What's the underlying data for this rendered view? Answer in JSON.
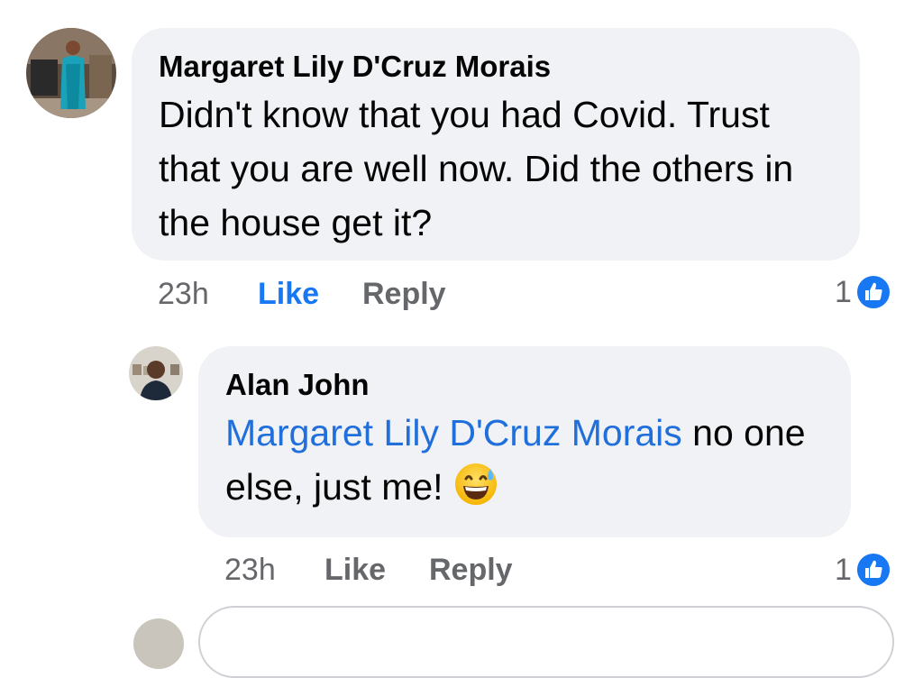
{
  "comments": [
    {
      "author": "Margaret Lily D'Cruz Morais",
      "text": "Didn't know that you had Covid. Trust that you are well now. Did the others in the house get it?",
      "time": "23h",
      "like_label": "Like",
      "reply_label": "Reply",
      "reaction_count": "1",
      "reaction_icon": "like-thumbs-up-icon",
      "like_active": true
    },
    {
      "author": "Alan John",
      "mention": "Margaret Lily D'Cruz Morais",
      "text": " no one else, just me! ",
      "emoji": "grinning-face-with-sweat-emoji",
      "time": "23h",
      "like_label": "Like",
      "reply_label": "Reply",
      "reaction_count": "1",
      "reaction_icon": "like-thumbs-up-icon",
      "like_active": false
    }
  ],
  "colors": {
    "bubble_bg": "#f0f2f5",
    "mention": "#216fdb",
    "like_active": "#1877f2",
    "meta_text": "#65676b",
    "like_badge": "#1877f2"
  }
}
